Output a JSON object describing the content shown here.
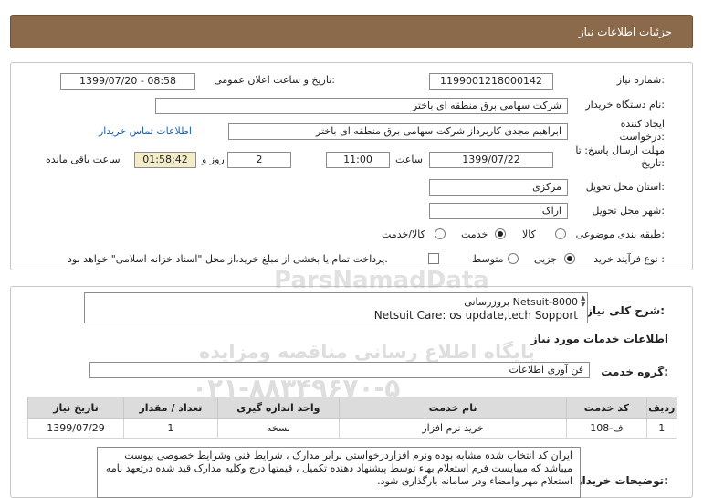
{
  "header": {
    "title": "جزئیات اطلاعات نیاز"
  },
  "fields": {
    "need_number_label": "شماره نیاز:",
    "need_number": "1199001218000142",
    "announce_label": "تاریخ و ساعت اعلان عمومی:",
    "announce_value": "1399/07/20 - 08:58",
    "buyer_org_label": "نام دستگاه خریدار:",
    "buyer_org": "شرکت سهامی برق منطقه ای باختر",
    "creator_label": "ایجاد کننده درخواست:",
    "creator": "ابراهیم مجدی کاربرداز شرکت سهامی برق منطقه ای باختر",
    "contact_link": "اطلاعات تماس خریدار",
    "deadline_label": "مهلت ارسال پاسخ: تا تاریخ:",
    "deadline_date": "1399/07/22",
    "time_label": "ساعت",
    "deadline_time": "11:00",
    "days_value": "2",
    "days_label": "روز و",
    "remaining_time": "01:58:42",
    "remaining_label": "ساعت باقی مانده",
    "province_label": "استان محل تحویل:",
    "province": "مرکزی",
    "city_label": "شهر محل تحویل:",
    "city": "اراک",
    "category_label": "طبقه بندی موضوعی:",
    "category_options": [
      "کالا",
      "خدمت",
      "کالا/خدمت"
    ],
    "category_selected": "خدمت",
    "process_label": "نوع فرآیند خرید :",
    "process_options": [
      "جزیی",
      "متوسط"
    ],
    "process_selected": "جزیی",
    "payment_note": "پرداخت تمام یا بخشی از مبلغ خرید،از محل \"اسناد خزانه اسلامی\" خواهد بود."
  },
  "summary": {
    "label": "شرح کلی نیاز:",
    "line1": "بروزرسانی Netsuit-8000",
    "line2": "Netsuit Care: os update,tech Sopport"
  },
  "services_section": {
    "title": "اطلاعات خدمات مورد نیاز",
    "group_label": "گروه خدمت:",
    "group_value": "فن آوری اطلاعات"
  },
  "table": {
    "headers": [
      "ردیف",
      "کد خدمت",
      "نام خدمت",
      "واحد اندازه گیری",
      "تعداد / مقدار",
      "تاریخ نیاز"
    ],
    "rows": [
      [
        "1",
        "ف-108",
        "خرید نرم افزار",
        "نسخه",
        "1",
        "1399/07/29"
      ]
    ]
  },
  "buyer_notes": {
    "label": "توضیحات خریدار:",
    "text": "ایران کد انتخاب شده مشابه بوده ونرم افزاردرخواستی برابر مدارک ، شرایط فنی وشرایط خصوصی پیوست میباشد که میبایست فرم استعلام بهاء توسط پیشنهاد دهنده تکمیل ، قیمتها درج وکلیه مدارک قید شده درتعهد نامه استعلام مهر وامضاء ودر سامانه بارگذاری شود."
  },
  "watermark": {
    "brand": "ParsNamadData",
    "line1": "پایگاه اطلاع رسانی مناقصه ومزایده",
    "line2": "۰۲۱-۸۸۳۴۹۶۷۰-۵"
  }
}
